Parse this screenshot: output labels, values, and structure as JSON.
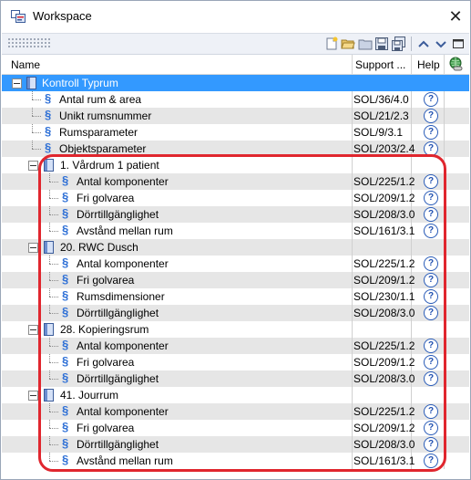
{
  "window": {
    "title": "Workspace",
    "close_glyph": "✕"
  },
  "toolbar": {
    "icons": [
      "new-icon",
      "open-folder-icon",
      "folder-icon",
      "save-icon",
      "save-all-icon",
      "move-up-icon",
      "move-down-icon",
      "maximize-icon"
    ]
  },
  "columns": {
    "name": "Name",
    "support": "Support ...",
    "help": "Help"
  },
  "help_glyph": "?",
  "section_glyph": "§",
  "rows": [
    {
      "label": "Kontroll Typrum",
      "support": "",
      "kind": "root"
    },
    {
      "label": "Antal rum & area",
      "support": "SOL/36/4.0",
      "kind": "rule1"
    },
    {
      "label": "Unikt rumsnummer",
      "support": "SOL/21/2.3",
      "kind": "rule1"
    },
    {
      "label": "Rumsparameter",
      "support": "SOL/9/3.1",
      "kind": "rule1"
    },
    {
      "label": "Objektsparameter",
      "support": "SOL/203/2.4",
      "kind": "rule1"
    },
    {
      "label": "1. Vårdrum 1 patient",
      "support": "",
      "kind": "group"
    },
    {
      "label": "Antal komponenter",
      "support": "SOL/225/1.2",
      "kind": "rule2"
    },
    {
      "label": "Fri golvarea",
      "support": "SOL/209/1.2",
      "kind": "rule2"
    },
    {
      "label": "Dörrtillgänglighet",
      "support": "SOL/208/3.0",
      "kind": "rule2"
    },
    {
      "label": "Avstånd mellan rum",
      "support": "SOL/161/3.1",
      "kind": "rule2"
    },
    {
      "label": "20. RWC Dusch",
      "support": "",
      "kind": "group"
    },
    {
      "label": "Antal komponenter",
      "support": "SOL/225/1.2",
      "kind": "rule2"
    },
    {
      "label": "Fri golvarea",
      "support": "SOL/209/1.2",
      "kind": "rule2"
    },
    {
      "label": "Rumsdimensioner",
      "support": "SOL/230/1.1",
      "kind": "rule2"
    },
    {
      "label": "Dörrtillgänglighet",
      "support": "SOL/208/3.0",
      "kind": "rule2"
    },
    {
      "label": "28. Kopieringsrum",
      "support": "",
      "kind": "group"
    },
    {
      "label": "Antal komponenter",
      "support": "SOL/225/1.2",
      "kind": "rule2"
    },
    {
      "label": "Fri golvarea",
      "support": "SOL/209/1.2",
      "kind": "rule2"
    },
    {
      "label": "Dörrtillgänglighet",
      "support": "SOL/208/3.0",
      "kind": "rule2"
    },
    {
      "label": "41. Jourrum",
      "support": "",
      "kind": "group"
    },
    {
      "label": "Antal komponenter",
      "support": "SOL/225/1.2",
      "kind": "rule2"
    },
    {
      "label": "Fri golvarea",
      "support": "SOL/209/1.2",
      "kind": "rule2"
    },
    {
      "label": "Dörrtillgänglighet",
      "support": "SOL/208/3.0",
      "kind": "rule2"
    },
    {
      "label": "Avstånd mellan rum",
      "support": "SOL/161/3.1",
      "kind": "rule2"
    }
  ],
  "colors": {
    "selection": "#3399ff",
    "alt_row": "#e6e6e6",
    "annotation": "#e0262e",
    "section_icon": "#2d6fd6"
  }
}
